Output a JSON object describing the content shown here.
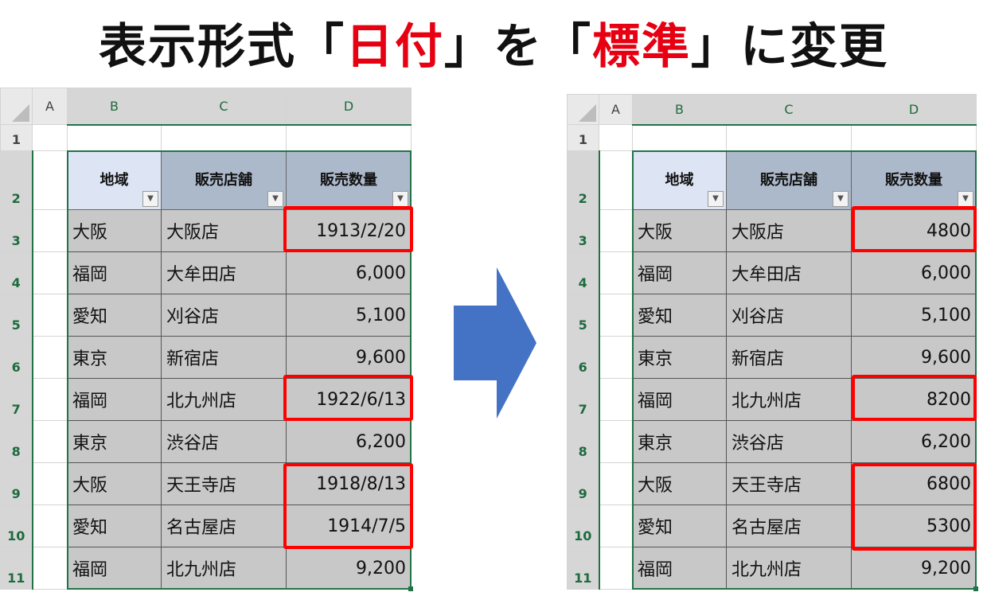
{
  "title": {
    "part1": "表示形式「",
    "highlight1": "日付",
    "part2": "」を「",
    "highlight2": "標準",
    "part3": "」に変更"
  },
  "colors": {
    "highlight_red": "#e60012",
    "box_red": "#ff0000",
    "arrow_blue": "#4472c4",
    "selection_green": "#217346",
    "table_header": "#acb9ca",
    "table_header_light": "#dde4f4",
    "table_body": "#c8c8c8"
  },
  "columns": [
    "A",
    "B",
    "C",
    "D"
  ],
  "rows": [
    "1",
    "2",
    "3",
    "4",
    "5",
    "6",
    "7",
    "8",
    "9",
    "10",
    "11"
  ],
  "headers": {
    "region": "地域",
    "store": "販売店舗",
    "qty": "販売数量"
  },
  "before": {
    "rows": [
      {
        "region": "大阪",
        "store": "大阪店",
        "qty": "1913/2/20"
      },
      {
        "region": "福岡",
        "store": "大牟田店",
        "qty": "6,000"
      },
      {
        "region": "愛知",
        "store": "刈谷店",
        "qty": "5,100"
      },
      {
        "region": "東京",
        "store": "新宿店",
        "qty": "9,600"
      },
      {
        "region": "福岡",
        "store": "北九州店",
        "qty": "1922/6/13"
      },
      {
        "region": "東京",
        "store": "渋谷店",
        "qty": "6,200"
      },
      {
        "region": "大阪",
        "store": "天王寺店",
        "qty": "1918/8/13"
      },
      {
        "region": "愛知",
        "store": "名古屋店",
        "qty": "1914/7/5"
      },
      {
        "region": "福岡",
        "store": "北九州店",
        "qty": "9,200"
      }
    ]
  },
  "after": {
    "rows": [
      {
        "region": "大阪",
        "store": "大阪店",
        "qty": "4800"
      },
      {
        "region": "福岡",
        "store": "大牟田店",
        "qty": "6,000"
      },
      {
        "region": "愛知",
        "store": "刈谷店",
        "qty": "5,100"
      },
      {
        "region": "東京",
        "store": "新宿店",
        "qty": "9,600"
      },
      {
        "region": "福岡",
        "store": "北九州店",
        "qty": "8200"
      },
      {
        "region": "東京",
        "store": "渋谷店",
        "qty": "6,200"
      },
      {
        "region": "大阪",
        "store": "天王寺店",
        "qty": "6800"
      },
      {
        "region": "愛知",
        "store": "名古屋店",
        "qty": "5300"
      },
      {
        "region": "福岡",
        "store": "北九州店",
        "qty": "9,200"
      }
    ]
  },
  "icons": {
    "filter": "filter-dropdown-icon",
    "arrow": "right-arrow-icon",
    "corner": "select-all-icon"
  }
}
